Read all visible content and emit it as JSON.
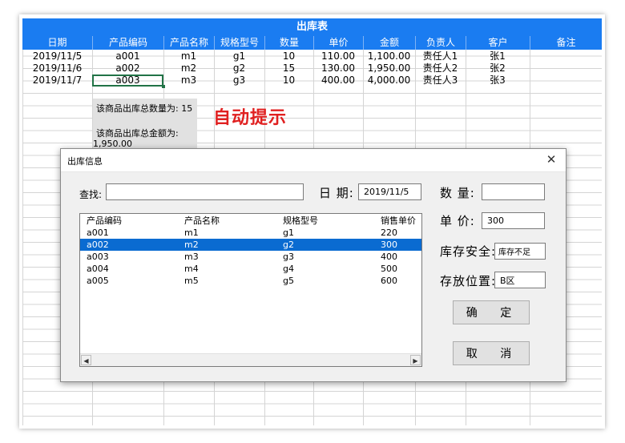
{
  "sheet": {
    "title": "出库表",
    "headers": [
      "日期",
      "产品编码",
      "产品名称",
      "规格型号",
      "数量",
      "单价",
      "金额",
      "负责人",
      "客户",
      "备注"
    ],
    "rows": [
      [
        "2019/11/5",
        "a001",
        "m1",
        "g1",
        "10",
        "110.00",
        "1,100.00",
        "责任人1",
        "张1",
        ""
      ],
      [
        "2019/11/6",
        "a002",
        "m2",
        "g2",
        "15",
        "130.00",
        "1,950.00",
        "责任人2",
        "张2",
        ""
      ],
      [
        "2019/11/7",
        "a003",
        "m3",
        "g3",
        "10",
        "400.00",
        "4,000.00",
        "责任人3",
        "张3",
        ""
      ]
    ],
    "summary_qty_label": "该商品出库总数量为: 15",
    "summary_amount_label": "该商品出库总金额为:",
    "summary_amount_value": "1,950.00",
    "auto_hint": "自动提示",
    "colors": {
      "header": "#1a7cf1",
      "hint": "#e02020",
      "selection": "#217346"
    }
  },
  "dialog": {
    "title": "出库信息",
    "close_icon": "close-icon",
    "search_label": "查找:",
    "search_value": "",
    "date_label": "日 期:",
    "date_value": "2019/11/5",
    "qty_label": "数 量:",
    "qty_value": "",
    "price_label": "单 价:",
    "price_value": "300",
    "stock_label": "库存安全:",
    "stock_value": "库存不足",
    "location_label": "存放位置:",
    "location_value": "B区",
    "confirm_label": "确 定",
    "cancel_label": "取 消",
    "list": {
      "headers": [
        "产品编码",
        "产品名称",
        "规格型号",
        "销售单价"
      ],
      "rows": [
        [
          "a001",
          "m1",
          "g1",
          "220"
        ],
        [
          "a002",
          "m2",
          "g2",
          "300"
        ],
        [
          "a003",
          "m3",
          "g3",
          "400"
        ],
        [
          "a004",
          "m4",
          "g4",
          "500"
        ],
        [
          "a005",
          "m5",
          "g5",
          "600"
        ]
      ],
      "selected_index": 1,
      "scroll_left_icon": "chevron-left-icon",
      "scroll_right_icon": "chevron-right-icon",
      "scroll_left_glyph": "◀",
      "scroll_right_glyph": "▶"
    }
  }
}
